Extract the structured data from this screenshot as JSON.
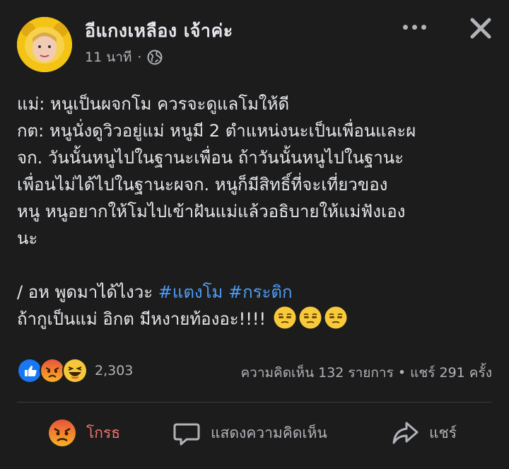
{
  "post": {
    "author": "อีแกงเหลือง เจ้าค่ะ",
    "time": "11 นาที",
    "separator": "·",
    "lines": [
      "แม่: หนูเป็นผจกโม ควรจะดูแลโมให้ดี",
      "กต: หนูนั่งดูวิวอยู่แม่ หนูมี 2 ตำแหน่งนะเป็นเพื่อนและผ",
      "จก. วันนั้นหนูไปในฐานะเพื่อน ถ้าวันนั้นหนูไปในฐานะ",
      "เพื่อนไม่ได้ไปในฐานะผจก. หนูก็มีสิทธิ์ที่จะเที่ยวของ",
      "หนู หนูอยากให้โมไปเข้าฝันแม่แล้วอธิบายให้แม่ฟังเอง",
      "นะ"
    ],
    "line7_text": "/ อห พูดมาได้ไงวะ ",
    "hashtag1": "#แตงโม",
    "hashtag2": "#กระติก",
    "line8_text": "ถ้ากูเป็นแม่ อิกต มีหงายท้องอะ!!!! ",
    "emoji_name": "unamused-face-emoji"
  },
  "reactions": {
    "icons": [
      "like-reaction-icon",
      "angry-reaction-icon",
      "haha-reaction-icon"
    ],
    "count": "2,303"
  },
  "stats": {
    "comments": "ความคิดเห็น 132 รายการ",
    "dot": "•",
    "shares": "แชร์ 291 ครั้ง"
  },
  "actions": {
    "react_label": "โกรธ",
    "comment_label": "แสดงความคิดเห็น",
    "share_label": "แชร์"
  },
  "colors": {
    "background": "#1c1c1c",
    "text": "#e4e6eb",
    "secondary": "#b0b3b8",
    "hashtag": "#4d9cf6",
    "angry": "#f0746f",
    "avatar_bg": "#f3c316"
  }
}
